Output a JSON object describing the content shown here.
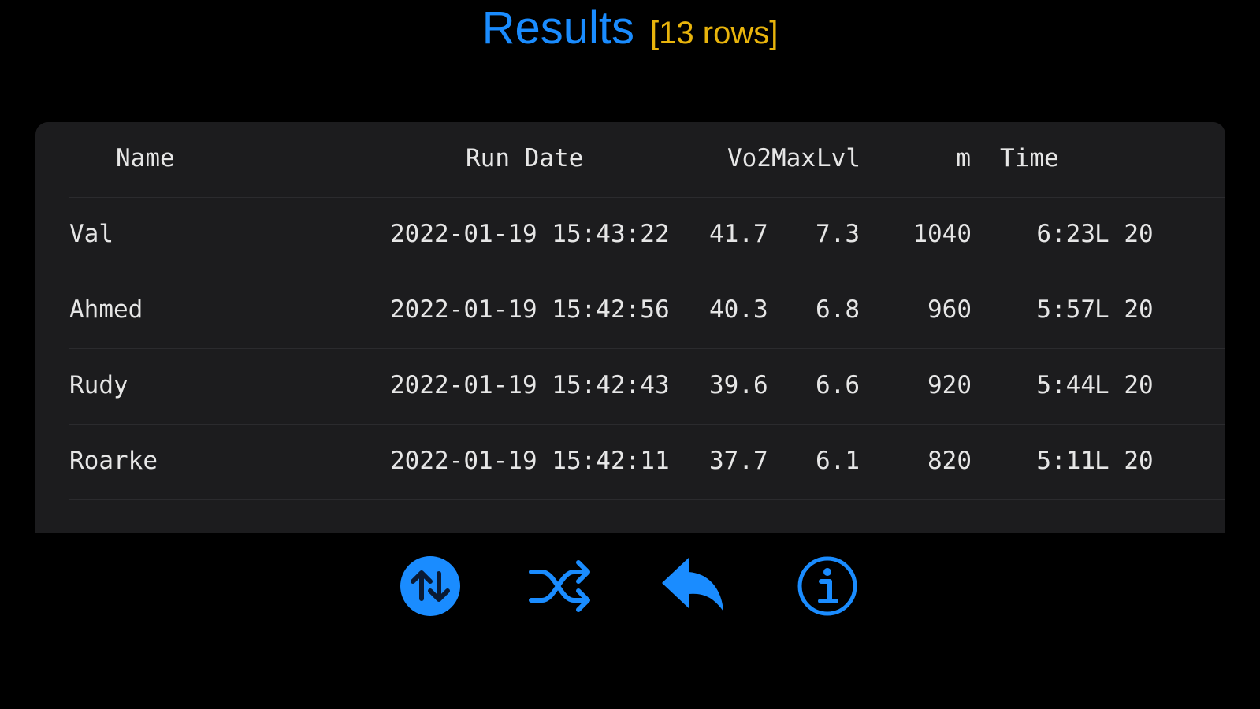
{
  "header": {
    "title": "Results",
    "row_count": "[13 rows]"
  },
  "table": {
    "columns": {
      "name": "Name",
      "run_date": "Run Date",
      "vo2max": "Vo2Max",
      "lvl": "Lvl",
      "m": "m",
      "time": "Time"
    },
    "rows": [
      {
        "name": "Val",
        "run_date": "2022-01-19 15:43:22",
        "vo2max": "41.7",
        "lvl": "7.3",
        "m": "1040",
        "time": "6:23",
        "stage": "L 20"
      },
      {
        "name": "Ahmed",
        "run_date": "2022-01-19 15:42:56",
        "vo2max": "40.3",
        "lvl": "6.8",
        "m": "960",
        "time": "5:57",
        "stage": "L 20"
      },
      {
        "name": "Rudy",
        "run_date": "2022-01-19 15:42:43",
        "vo2max": "39.6",
        "lvl": "6.6",
        "m": "920",
        "time": "5:44",
        "stage": "L 20"
      },
      {
        "name": "Roarke",
        "run_date": "2022-01-19 15:42:11",
        "vo2max": "37.7",
        "lvl": "6.1",
        "m": "820",
        "time": "5:11",
        "stage": "L 20"
      }
    ]
  },
  "toolbar": {
    "sort_icon": "sort-arrows-circle-icon",
    "shuffle_icon": "shuffle-icon",
    "back_icon": "reply-arrow-icon",
    "info_icon": "info-circle-icon"
  },
  "colors": {
    "accent": "#1a8cff",
    "row_count": "#e8b40c",
    "card_bg": "#1c1c1e",
    "text": "#e6e6e6"
  }
}
